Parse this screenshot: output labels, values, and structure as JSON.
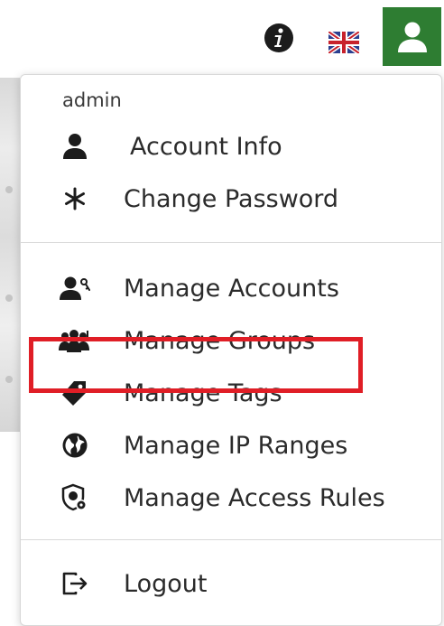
{
  "topbar": {
    "info_icon": "info-circle-icon",
    "language_icon": "uk-flag-icon",
    "user_icon": "user-icon",
    "user_button_color": "#2e7d32"
  },
  "menu": {
    "username": "admin",
    "items": [
      {
        "label": "Account Info",
        "icon": "person-icon"
      },
      {
        "label": "Change Password",
        "icon": "asterisk-icon"
      },
      {
        "label": "Manage Accounts",
        "icon": "user-key-icon"
      },
      {
        "label": "Manage Groups",
        "icon": "group-icon"
      },
      {
        "label": "Manage Tags",
        "icon": "tag-icon"
      },
      {
        "label": "Manage IP Ranges",
        "icon": "globe-icon",
        "highlighted": true
      },
      {
        "label": "Manage Access Rules",
        "icon": "shield-gear-icon"
      },
      {
        "label": "Logout",
        "icon": "logout-icon"
      }
    ]
  },
  "highlight_color": "#e01e26"
}
